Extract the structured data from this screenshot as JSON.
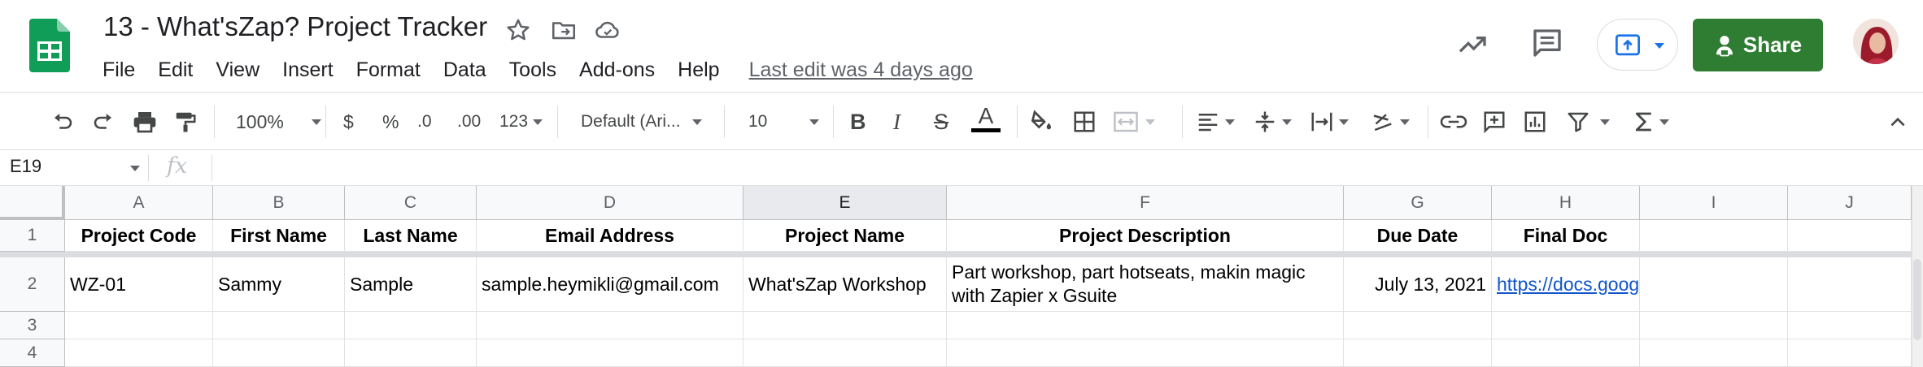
{
  "app": {
    "title": "13 - What'sZap? Project Tracker",
    "menu": [
      "File",
      "Edit",
      "View",
      "Insert",
      "Format",
      "Data",
      "Tools",
      "Add-ons",
      "Help"
    ],
    "last_edit": "Last edit was 4 days ago",
    "share_label": "Share"
  },
  "toolbar": {
    "zoom": "100%",
    "currency": "$",
    "percent": "%",
    "dec_decrease": ".0",
    "dec_increase": ".00",
    "more_formats": "123",
    "font": "Default (Ari...",
    "font_size": "10",
    "bold": "B",
    "italic": "I",
    "strike": "S",
    "text_color": "A",
    "text_color_swatch": "#000000"
  },
  "formula_bar": {
    "cell_ref": "E19",
    "fx": "fx",
    "content": ""
  },
  "sheet": {
    "columns": [
      "A",
      "B",
      "C",
      "D",
      "E",
      "F",
      "G",
      "H",
      "I",
      "J"
    ],
    "selected_column": "E",
    "row_numbers": [
      "1",
      "2",
      "3",
      "4"
    ],
    "header_row": [
      "Project Code",
      "First Name",
      "Last Name",
      "Email Address",
      "Project Name",
      "Project Description",
      "Due Date",
      "Final Doc",
      "",
      ""
    ],
    "data_row": {
      "project_code": "WZ-01",
      "first_name": "Sammy",
      "last_name": "Sample",
      "email": "sample.heymikli@gmail.com",
      "project_name": "What'sZap Workshop",
      "description": "Part workshop, part hotseats, makin magic with Zapier x Gsuite",
      "due_date": "July 13, 2021",
      "final_doc": "https://docs.goog"
    }
  },
  "colors": {
    "brand_green": "#0f9d58",
    "share_button": "#2e7d32",
    "link": "#1155cc",
    "present_blue": "#1a73e8"
  }
}
